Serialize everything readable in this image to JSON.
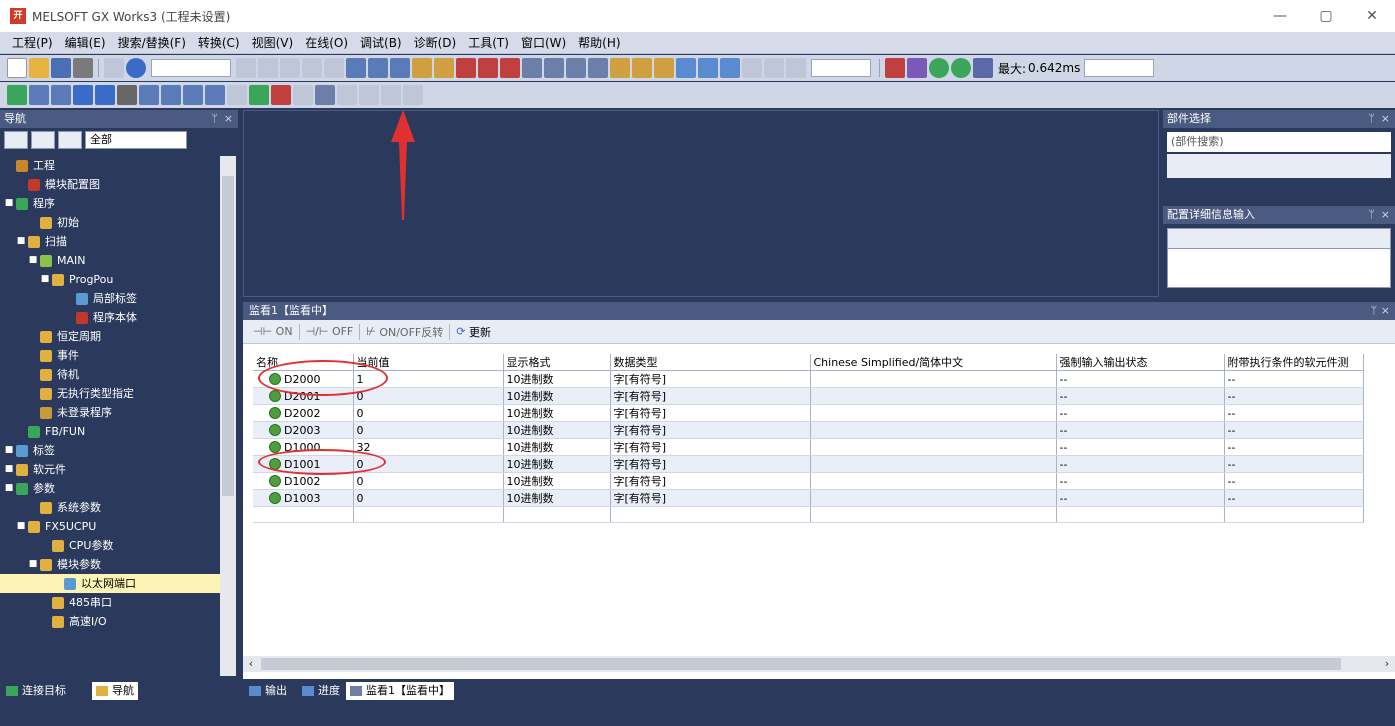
{
  "window": {
    "title": "MELSOFT GX Works3 (工程未设置)",
    "logo": "开",
    "controls": [
      "—",
      "▢",
      "✕"
    ]
  },
  "menu": [
    "工程(P)",
    "编辑(E)",
    "搜索/替换(F)",
    "转换(C)",
    "视图(V)",
    "在线(O)",
    "调试(B)",
    "诊断(D)",
    "工具(T)",
    "窗口(W)",
    "帮助(H)"
  ],
  "toolbar": {
    "max_label": "最大:",
    "max_value": "0.642ms"
  },
  "navigation": {
    "title": "导航",
    "filter": "全部",
    "tree": [
      {
        "label": "工程",
        "depth": 0,
        "exp": "",
        "icon": "project-icon",
        "color": "#c9872b"
      },
      {
        "label": "模块配置图",
        "depth": 1,
        "exp": "",
        "icon": "module-config-icon",
        "color": "#c0392b"
      },
      {
        "label": "程序",
        "depth": 0,
        "exp": "■",
        "icon": "program-icon",
        "color": "#3aa65a"
      },
      {
        "label": "初始",
        "depth": 2,
        "exp": "",
        "icon": "folder-icon",
        "color": "#e0b040"
      },
      {
        "label": "扫描",
        "depth": 1,
        "exp": "■",
        "icon": "folder-icon",
        "color": "#e0b040"
      },
      {
        "label": "MAIN",
        "depth": 2,
        "exp": "■",
        "icon": "main-icon",
        "color": "#8bc34a"
      },
      {
        "label": "ProgPou",
        "depth": 3,
        "exp": "■",
        "icon": "pou-icon",
        "color": "#e0b040"
      },
      {
        "label": "局部标签",
        "depth": 5,
        "exp": "",
        "icon": "label-icon",
        "color": "#5a9bd4"
      },
      {
        "label": "程序本体",
        "depth": 5,
        "exp": "",
        "icon": "program-body-icon",
        "color": "#c0392b"
      },
      {
        "label": "恒定周期",
        "depth": 2,
        "exp": "",
        "icon": "folder-icon",
        "color": "#e0b040"
      },
      {
        "label": "事件",
        "depth": 2,
        "exp": "",
        "icon": "folder-icon",
        "color": "#e0b040"
      },
      {
        "label": "待机",
        "depth": 2,
        "exp": "",
        "icon": "folder-icon",
        "color": "#e0b040"
      },
      {
        "label": "无执行类型指定",
        "depth": 2,
        "exp": "",
        "icon": "folder-icon",
        "color": "#e0b040"
      },
      {
        "label": "未登录程序",
        "depth": 2,
        "exp": "",
        "icon": "unregistered-icon",
        "color": "#c49a3a"
      },
      {
        "label": "FB/FUN",
        "depth": 1,
        "exp": "",
        "icon": "fb-icon",
        "color": "#3aa65a"
      },
      {
        "label": "标签",
        "depth": 0,
        "exp": "■",
        "icon": "label-icon",
        "color": "#5a9bd4"
      },
      {
        "label": "软元件",
        "depth": 0,
        "exp": "■",
        "icon": "device-icon",
        "color": "#e0b040"
      },
      {
        "label": "参数",
        "depth": 0,
        "exp": "■",
        "icon": "parameter-icon",
        "color": "#3aa65a"
      },
      {
        "label": "系统参数",
        "depth": 2,
        "exp": "",
        "icon": "parameter-icon",
        "color": "#e0b040"
      },
      {
        "label": "FX5UCPU",
        "depth": 1,
        "exp": "■",
        "icon": "cpu-icon",
        "color": "#e0b040"
      },
      {
        "label": "CPU参数",
        "depth": 3,
        "exp": "",
        "icon": "parameter-icon",
        "color": "#e0b040"
      },
      {
        "label": "模块参数",
        "depth": 2,
        "exp": "■",
        "icon": "module-param-icon",
        "color": "#e0b040"
      },
      {
        "label": "以太网端口",
        "depth": 4,
        "exp": "",
        "icon": "ethernet-icon",
        "color": "#5a9bd4",
        "selected": true
      },
      {
        "label": "485串口",
        "depth": 3,
        "exp": "",
        "icon": "serial-icon",
        "color": "#e0b040"
      },
      {
        "label": "高速I/O",
        "depth": 3,
        "exp": "",
        "icon": "highspeed-io-icon",
        "color": "#e0b040"
      }
    ]
  },
  "parts": {
    "title": "部件选择",
    "search_placeholder": "(部件搜索)"
  },
  "detail": {
    "title": "配置详细信息输入"
  },
  "watch": {
    "title": "监看1【监看中】",
    "buttons": [
      "ON",
      "OFF",
      "ON/OFF反转",
      "更新"
    ],
    "columns": [
      "名称",
      "当前值",
      "显示格式",
      "数据类型",
      "Chinese Simplified/简体中文",
      "强制输入输出状态",
      "附带执行条件的软元件测"
    ],
    "rows": [
      {
        "name": "D2000",
        "value": "1",
        "format": "10进制数",
        "type": "字[有符号]",
        "comment": "",
        "force": "--",
        "cond": "--"
      },
      {
        "name": "D2001",
        "value": "0",
        "format": "10进制数",
        "type": "字[有符号]",
        "comment": "",
        "force": "--",
        "cond": "--"
      },
      {
        "name": "D2002",
        "value": "0",
        "format": "10进制数",
        "type": "字[有符号]",
        "comment": "",
        "force": "--",
        "cond": "--"
      },
      {
        "name": "D2003",
        "value": "0",
        "format": "10进制数",
        "type": "字[有符号]",
        "comment": "",
        "force": "--",
        "cond": "--"
      },
      {
        "name": "D1000",
        "value": "32",
        "format": "10进制数",
        "type": "字[有符号]",
        "comment": "",
        "force": "--",
        "cond": "--"
      },
      {
        "name": "D1001",
        "value": "0",
        "format": "10进制数",
        "type": "字[有符号]",
        "comment": "",
        "force": "--",
        "cond": "--"
      },
      {
        "name": "D1002",
        "value": "0",
        "format": "10进制数",
        "type": "字[有符号]",
        "comment": "",
        "force": "--",
        "cond": "--"
      },
      {
        "name": "D1003",
        "value": "0",
        "format": "10进制数",
        "type": "字[有符号]",
        "comment": "",
        "force": "--",
        "cond": "--"
      }
    ]
  },
  "bottom_tabs": {
    "left": [
      "连接目标",
      "导航"
    ],
    "right": [
      "输出",
      "进度",
      "监看1【监看中】"
    ]
  },
  "colors": {
    "accent": "#4a5a80",
    "annotation": "#e03030",
    "device_icon": "#4e9e3c"
  }
}
